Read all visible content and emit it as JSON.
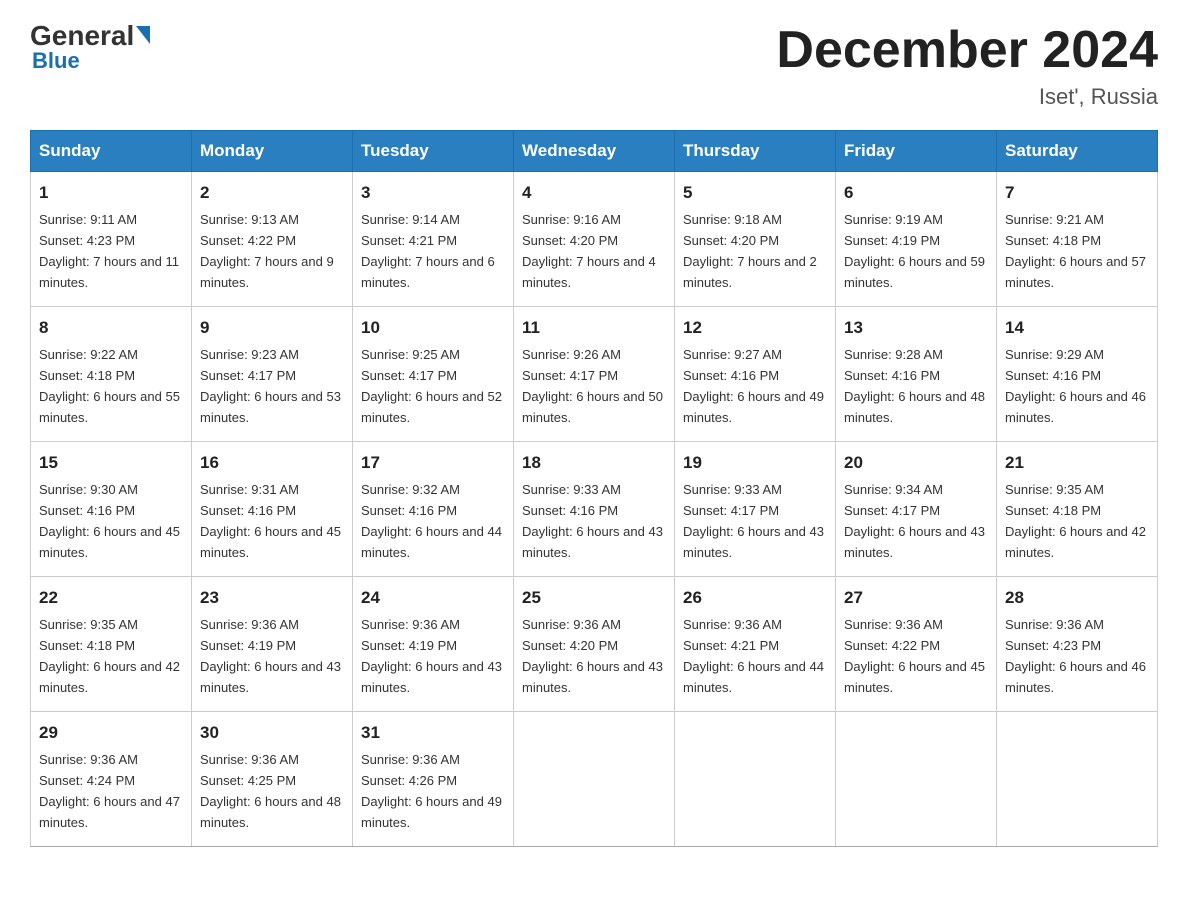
{
  "header": {
    "logo_general": "General",
    "logo_blue": "Blue",
    "month_title": "December 2024",
    "location": "Iset', Russia"
  },
  "days_of_week": [
    "Sunday",
    "Monday",
    "Tuesday",
    "Wednesday",
    "Thursday",
    "Friday",
    "Saturday"
  ],
  "weeks": [
    [
      {
        "day": "1",
        "sunrise": "9:11 AM",
        "sunset": "4:23 PM",
        "daylight": "7 hours and 11 minutes."
      },
      {
        "day": "2",
        "sunrise": "9:13 AM",
        "sunset": "4:22 PM",
        "daylight": "7 hours and 9 minutes."
      },
      {
        "day": "3",
        "sunrise": "9:14 AM",
        "sunset": "4:21 PM",
        "daylight": "7 hours and 6 minutes."
      },
      {
        "day": "4",
        "sunrise": "9:16 AM",
        "sunset": "4:20 PM",
        "daylight": "7 hours and 4 minutes."
      },
      {
        "day": "5",
        "sunrise": "9:18 AM",
        "sunset": "4:20 PM",
        "daylight": "7 hours and 2 minutes."
      },
      {
        "day": "6",
        "sunrise": "9:19 AM",
        "sunset": "4:19 PM",
        "daylight": "6 hours and 59 minutes."
      },
      {
        "day": "7",
        "sunrise": "9:21 AM",
        "sunset": "4:18 PM",
        "daylight": "6 hours and 57 minutes."
      }
    ],
    [
      {
        "day": "8",
        "sunrise": "9:22 AM",
        "sunset": "4:18 PM",
        "daylight": "6 hours and 55 minutes."
      },
      {
        "day": "9",
        "sunrise": "9:23 AM",
        "sunset": "4:17 PM",
        "daylight": "6 hours and 53 minutes."
      },
      {
        "day": "10",
        "sunrise": "9:25 AM",
        "sunset": "4:17 PM",
        "daylight": "6 hours and 52 minutes."
      },
      {
        "day": "11",
        "sunrise": "9:26 AM",
        "sunset": "4:17 PM",
        "daylight": "6 hours and 50 minutes."
      },
      {
        "day": "12",
        "sunrise": "9:27 AM",
        "sunset": "4:16 PM",
        "daylight": "6 hours and 49 minutes."
      },
      {
        "day": "13",
        "sunrise": "9:28 AM",
        "sunset": "4:16 PM",
        "daylight": "6 hours and 48 minutes."
      },
      {
        "day": "14",
        "sunrise": "9:29 AM",
        "sunset": "4:16 PM",
        "daylight": "6 hours and 46 minutes."
      }
    ],
    [
      {
        "day": "15",
        "sunrise": "9:30 AM",
        "sunset": "4:16 PM",
        "daylight": "6 hours and 45 minutes."
      },
      {
        "day": "16",
        "sunrise": "9:31 AM",
        "sunset": "4:16 PM",
        "daylight": "6 hours and 45 minutes."
      },
      {
        "day": "17",
        "sunrise": "9:32 AM",
        "sunset": "4:16 PM",
        "daylight": "6 hours and 44 minutes."
      },
      {
        "day": "18",
        "sunrise": "9:33 AM",
        "sunset": "4:16 PM",
        "daylight": "6 hours and 43 minutes."
      },
      {
        "day": "19",
        "sunrise": "9:33 AM",
        "sunset": "4:17 PM",
        "daylight": "6 hours and 43 minutes."
      },
      {
        "day": "20",
        "sunrise": "9:34 AM",
        "sunset": "4:17 PM",
        "daylight": "6 hours and 43 minutes."
      },
      {
        "day": "21",
        "sunrise": "9:35 AM",
        "sunset": "4:18 PM",
        "daylight": "6 hours and 42 minutes."
      }
    ],
    [
      {
        "day": "22",
        "sunrise": "9:35 AM",
        "sunset": "4:18 PM",
        "daylight": "6 hours and 42 minutes."
      },
      {
        "day": "23",
        "sunrise": "9:36 AM",
        "sunset": "4:19 PM",
        "daylight": "6 hours and 43 minutes."
      },
      {
        "day": "24",
        "sunrise": "9:36 AM",
        "sunset": "4:19 PM",
        "daylight": "6 hours and 43 minutes."
      },
      {
        "day": "25",
        "sunrise": "9:36 AM",
        "sunset": "4:20 PM",
        "daylight": "6 hours and 43 minutes."
      },
      {
        "day": "26",
        "sunrise": "9:36 AM",
        "sunset": "4:21 PM",
        "daylight": "6 hours and 44 minutes."
      },
      {
        "day": "27",
        "sunrise": "9:36 AM",
        "sunset": "4:22 PM",
        "daylight": "6 hours and 45 minutes."
      },
      {
        "day": "28",
        "sunrise": "9:36 AM",
        "sunset": "4:23 PM",
        "daylight": "6 hours and 46 minutes."
      }
    ],
    [
      {
        "day": "29",
        "sunrise": "9:36 AM",
        "sunset": "4:24 PM",
        "daylight": "6 hours and 47 minutes."
      },
      {
        "day": "30",
        "sunrise": "9:36 AM",
        "sunset": "4:25 PM",
        "daylight": "6 hours and 48 minutes."
      },
      {
        "day": "31",
        "sunrise": "9:36 AM",
        "sunset": "4:26 PM",
        "daylight": "6 hours and 49 minutes."
      },
      null,
      null,
      null,
      null
    ]
  ]
}
